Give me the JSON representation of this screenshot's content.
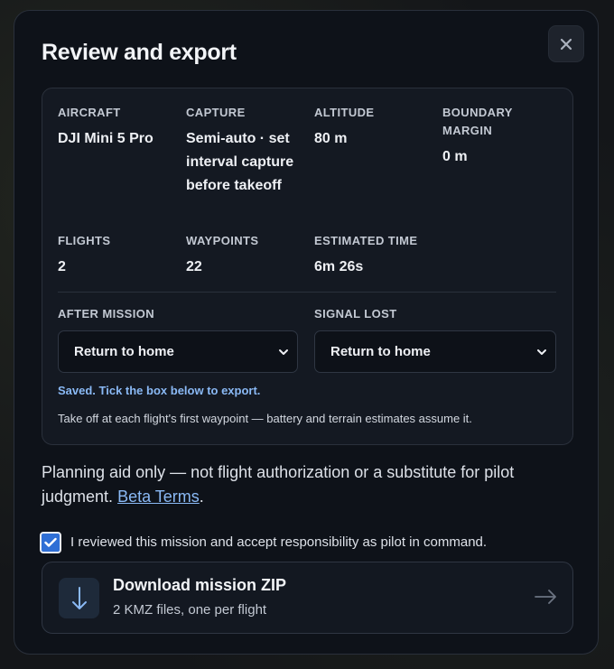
{
  "dialog": {
    "title": "Review and export",
    "close_icon": "close-icon"
  },
  "summary": {
    "aircraft": {
      "label": "AIRCRAFT",
      "value": "DJI Mini 5 Pro"
    },
    "capture": {
      "label": "CAPTURE",
      "value": "Semi-auto · set interval capture before takeoff"
    },
    "altitude": {
      "label": "ALTITUDE",
      "value": "80 m"
    },
    "boundary_margin": {
      "label": "BOUNDARY MARGIN",
      "value": "0 m"
    },
    "flights": {
      "label": "FLIGHTS",
      "value": "2"
    },
    "waypoints": {
      "label": "WAYPOINTS",
      "value": "22"
    },
    "estimated_time": {
      "label": "ESTIMATED TIME",
      "value": "6m 26s"
    },
    "after_mission": {
      "label": "AFTER MISSION",
      "selected": "Return to home"
    },
    "signal_lost": {
      "label": "SIGNAL LOST",
      "selected": "Return to home"
    },
    "saved_note": "Saved. Tick the box below to export.",
    "takeoff_note": "Take off at each flight's first waypoint — battery and terrain estimates assume it."
  },
  "disclaimer": {
    "text": "Planning aid only — not flight authorization or a substitute for pilot judgment.",
    "link_text": "Beta Terms",
    "period": "."
  },
  "acknowledge": {
    "checked": true,
    "label": "I reviewed this mission and accept responsibility as pilot in command."
  },
  "download": {
    "title": "Download mission ZIP",
    "subtitle": "2 KMZ files, one per flight",
    "icon": "download-arrow-icon",
    "arrow_icon": "arrow-right-icon"
  },
  "colors": {
    "accent": "#2f6fd6",
    "link": "#8ab9f5",
    "panel": "#0e1219"
  }
}
